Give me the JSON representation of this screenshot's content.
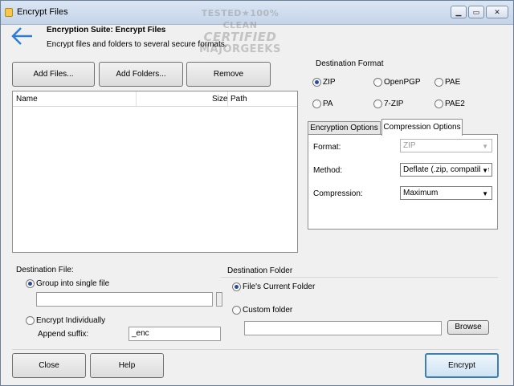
{
  "window": {
    "title": "Encrypt Files",
    "caption_buttons": {
      "minimize": "▁",
      "maximize": "▭",
      "close": "✕"
    }
  },
  "watermark": {
    "line1": "TESTED★100% CLEAN",
    "line2": "CERTIFIED",
    "line3": "MAJORGEEKS"
  },
  "header": {
    "back_icon": "back-arrow-icon",
    "title": "Encryption Suite: Encrypt Files",
    "description": "Encrypt files and folders to several secure formats."
  },
  "toolbar": {
    "add_files": "Add Files...",
    "add_folders": "Add Folders...",
    "remove": "Remove"
  },
  "file_list": {
    "columns": [
      "Name",
      "Size",
      "Path"
    ],
    "rows": []
  },
  "destination_format": {
    "label": "Destination Format",
    "options": [
      "ZIP",
      "OpenPGP",
      "PAE",
      "PA",
      "7-ZIP",
      "PAE2"
    ],
    "selected": "ZIP"
  },
  "tabs": {
    "encryption": "Encryption Options",
    "compression": "Compression Options",
    "active": "Compression Options"
  },
  "compression_options": {
    "format_label": "Format:",
    "format_value": "ZIP",
    "method_label": "Method:",
    "method_value": "Deflate (.zip, compatible",
    "compression_label": "Compression:",
    "compression_value": "Maximum"
  },
  "destination_file": {
    "label": "Destination File:",
    "group_label": "Group into single file",
    "group_selected": true,
    "single_file_value": "",
    "individual_label": "Encrypt Individually",
    "suffix_label": "Append suffix:",
    "suffix_value": "_enc"
  },
  "destination_folder": {
    "label": "Destination Folder",
    "current_label": "File's Current Folder",
    "current_selected": true,
    "custom_label": "Custom folder",
    "custom_value": "",
    "browse": "Browse"
  },
  "footer": {
    "close": "Close",
    "help": "Help",
    "encrypt": "Encrypt"
  },
  "colors": {
    "accent": "#3c7fb1",
    "back_arrow": "#2e7fd0"
  }
}
